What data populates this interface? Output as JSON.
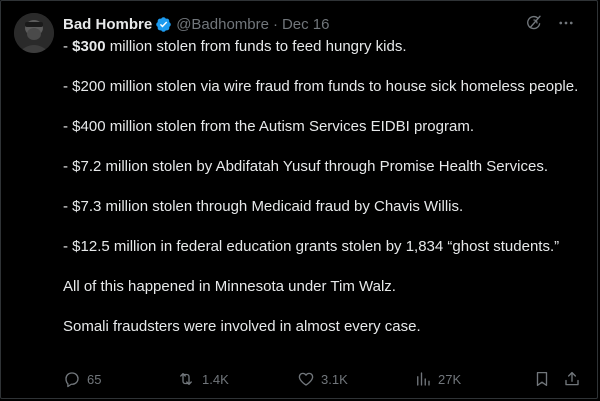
{
  "author": {
    "display_name": "Bad Hombre",
    "handle": "@Badhombre",
    "separator": "·",
    "date": "Dec 16"
  },
  "icons": {
    "verified": "verified-badge-icon",
    "grok": "grok-icon",
    "more": "more-icon",
    "reply": "reply-icon",
    "retweet": "retweet-icon",
    "like": "heart-icon",
    "views": "views-icon",
    "bookmark": "bookmark-icon",
    "share": "share-icon"
  },
  "colors": {
    "background": "#000000",
    "text": "#e7e9ea",
    "muted": "#71767b",
    "verified": "#1d9bf0",
    "border": "#2f3336"
  },
  "tweet": {
    "line1_prefix": "- ",
    "line1_amount": "$300",
    "line1_rest": " million stolen from funds to feed hungry kids.",
    "line2": "- $200 million stolen via wire fraud from funds to house sick homeless people.",
    "line3": "- $400 million stolen from the Autism Services EIDBI program.",
    "line4": "- $7.2 million stolen by Abdifatah Yusuf through Promise Health Services.",
    "line5": "- $7.3 million stolen through Medicaid fraud by Chavis Willis.",
    "line6": "- $12.5 million in federal education grants stolen by 1,834 “ghost students.”",
    "line7": "All of this happened in Minnesota under Tim Walz.",
    "line8": "Somali fraudsters were involved in almost every case."
  },
  "stats": {
    "replies": "65",
    "retweets": "1.4K",
    "likes": "3.1K",
    "views": "27K"
  }
}
